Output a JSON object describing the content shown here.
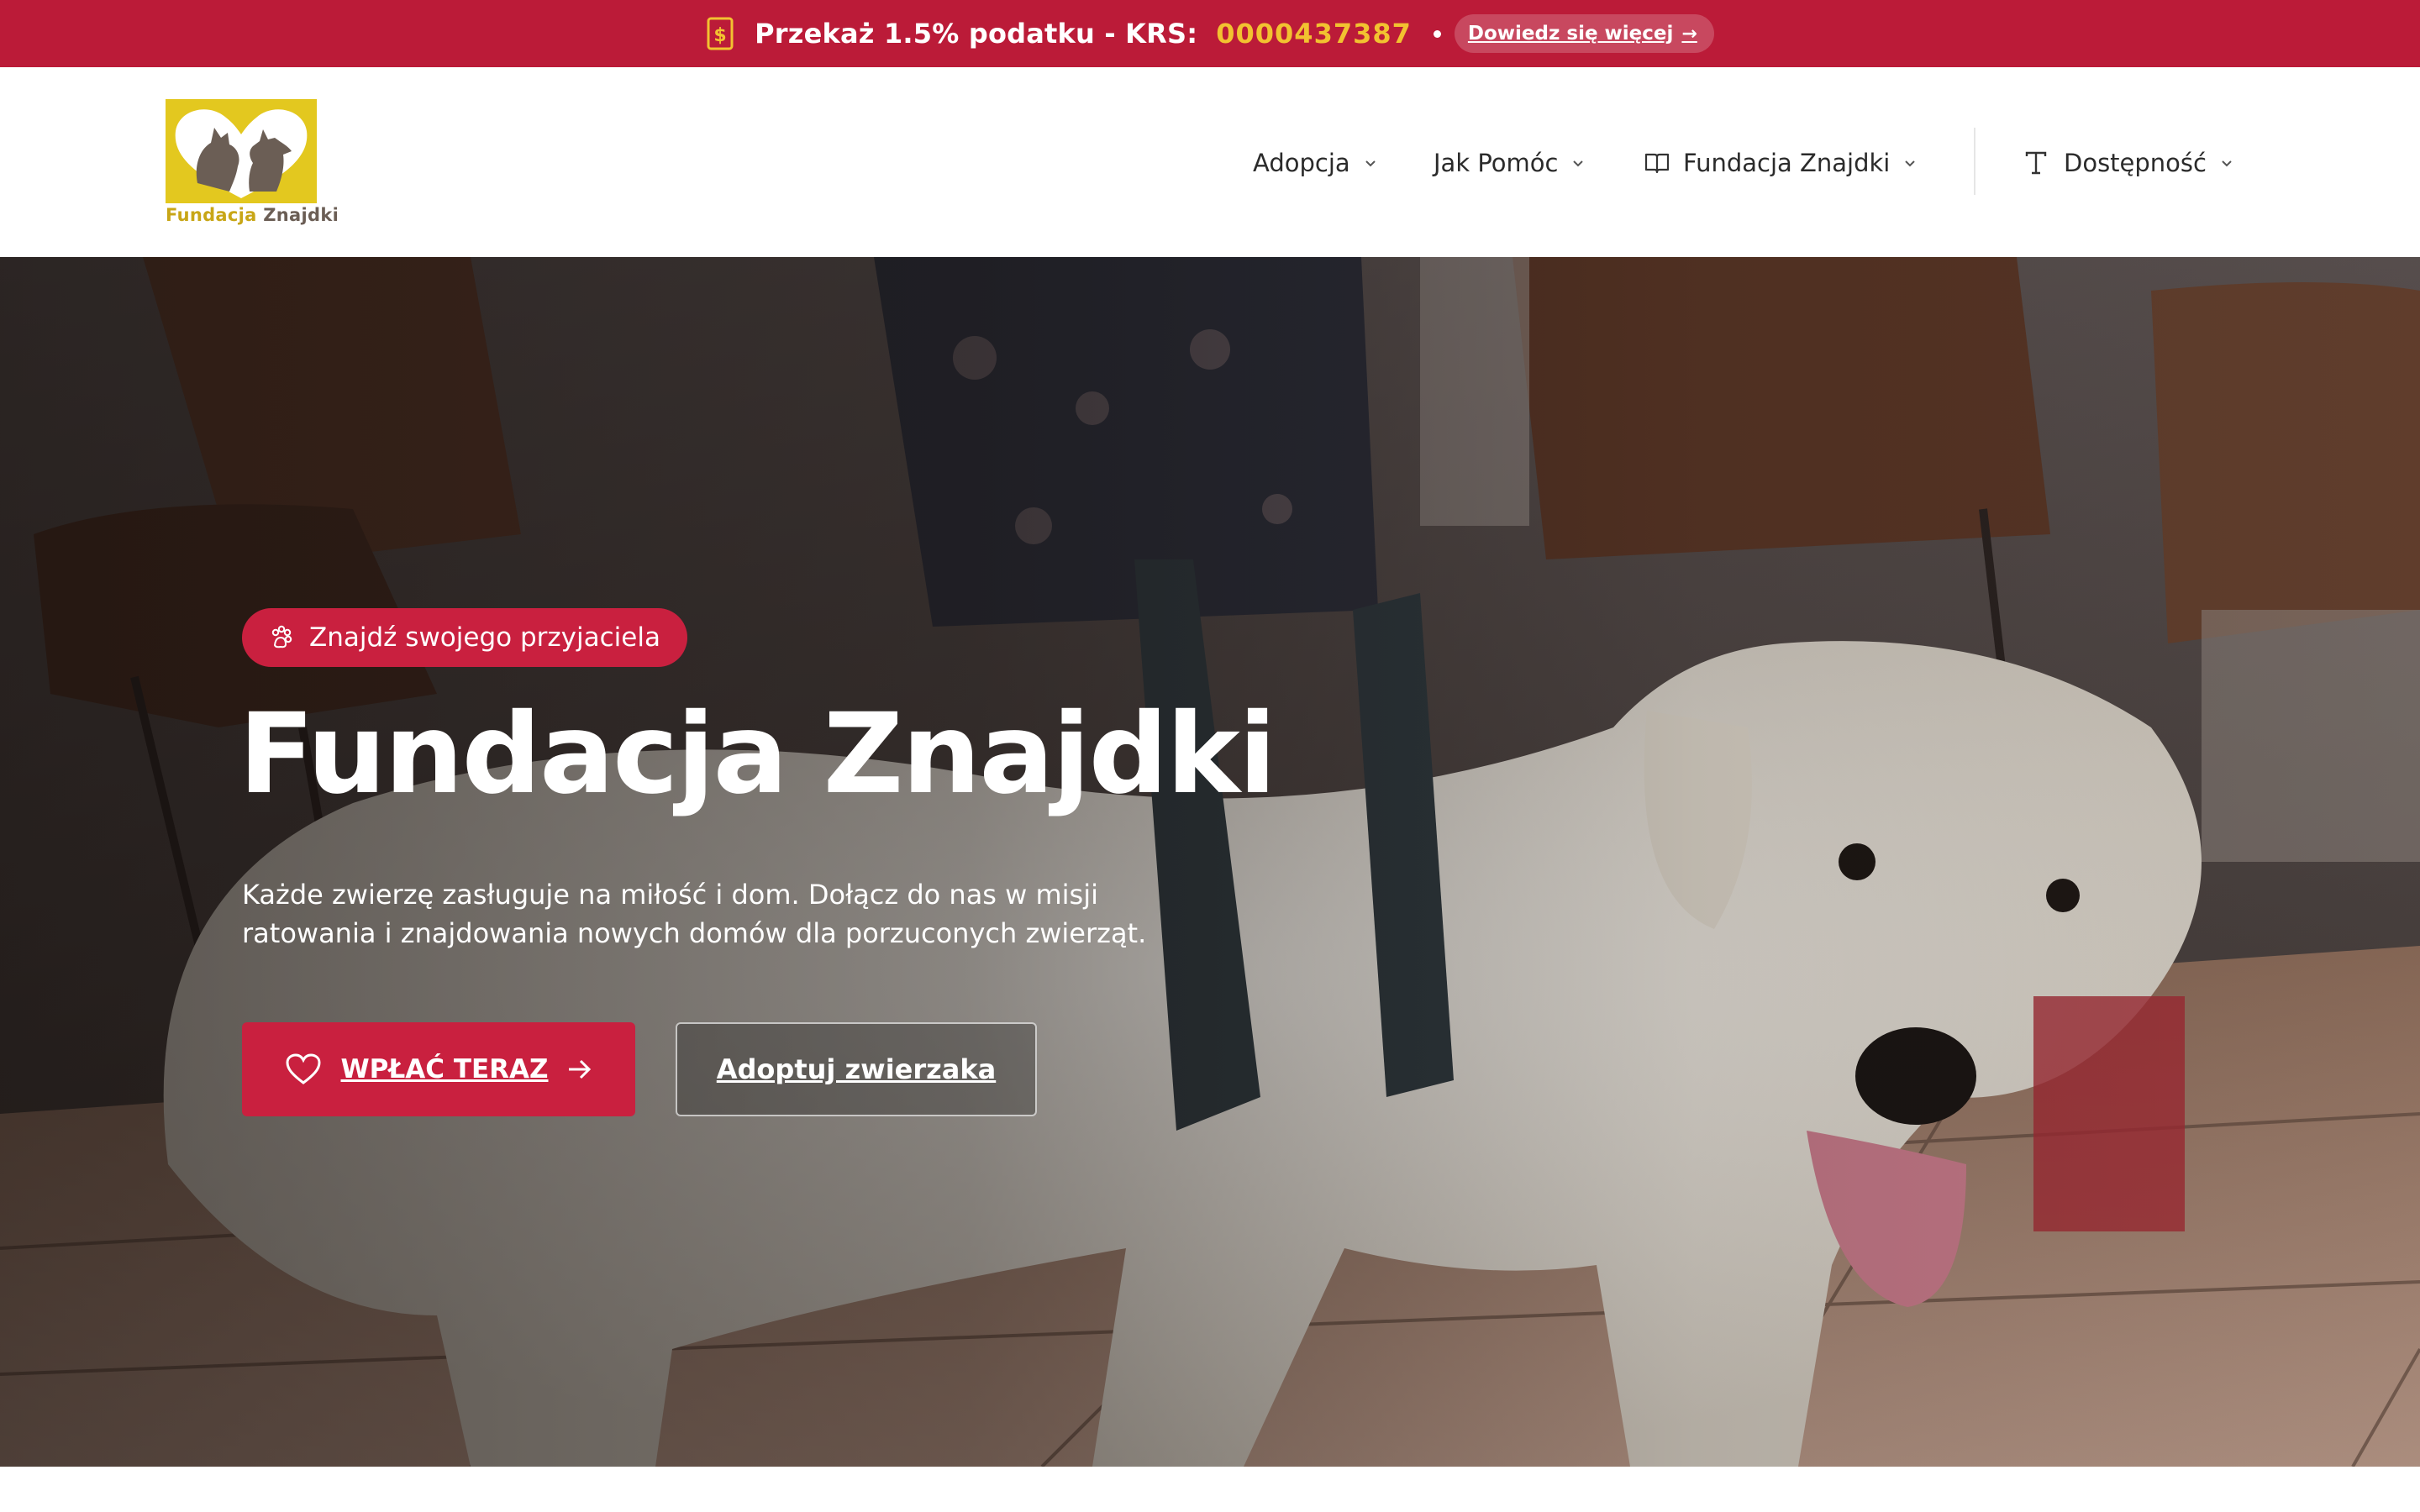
{
  "topbar": {
    "promo_text": "Przekaż 1.5% podatku - KRS:",
    "krs_number": "0000437387",
    "learn_more": "Dowiedz się więcej",
    "background_color": "#bb1b38",
    "accent_color": "#f2c230",
    "icon": "tax-document-icon"
  },
  "logo": {
    "word_part1": "Fundacja",
    "word_part2": "Znajdki",
    "background_color": "#e3c81f"
  },
  "nav": {
    "items": [
      {
        "label": "Adopcja",
        "icon": "chevron-down-icon"
      },
      {
        "label": "Jak Pomóc",
        "icon": "chevron-down-icon"
      },
      {
        "label": "Fundacja Znajdki",
        "icon": "book-icon"
      },
      {
        "label": "Dostępność",
        "icon": "text-size-icon"
      }
    ]
  },
  "hero": {
    "badge": "Znajdź swojego przyjaciela",
    "title": "Fundacja Znajdki",
    "description": "Każde zwierzę zasługuje na miłość i dom. Dołącz do nas w misji ratowania i znajdowania nowych domów dla porzuconych zwierząt.",
    "primary_button": "WPŁAĆ TERAZ",
    "secondary_button": "Adoptuj zwierzaka",
    "brand_color": "#c9203f"
  }
}
